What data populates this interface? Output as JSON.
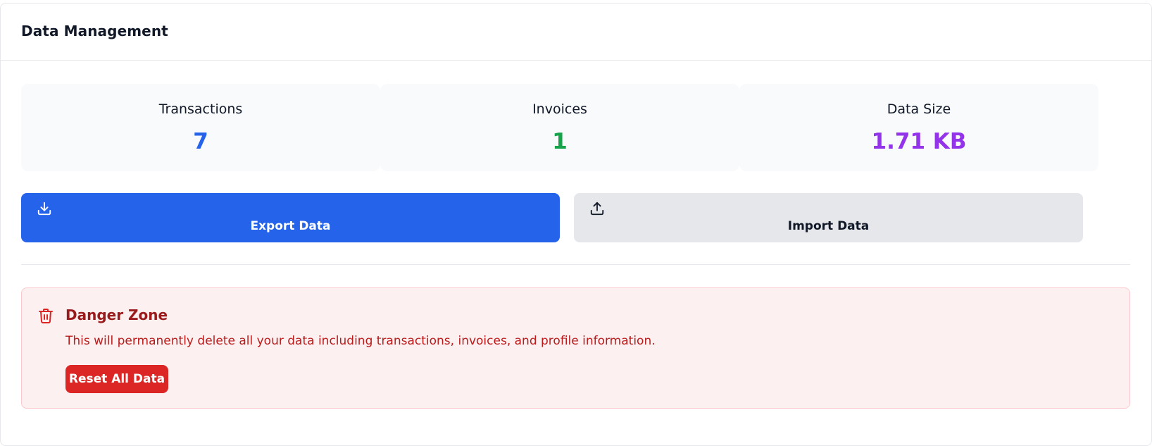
{
  "header": {
    "title": "Data Management"
  },
  "stats": [
    {
      "label": "Transactions",
      "value": "7",
      "color": "#2563eb"
    },
    {
      "label": "Invoices",
      "value": "1",
      "color": "#16a34a"
    },
    {
      "label": "Data Size",
      "value": "1.71 KB",
      "color": "#9333ea"
    }
  ],
  "actions": {
    "export": {
      "label": "Export Data",
      "icon": "download-icon",
      "bg": "#2563eb",
      "fg": "#ffffff"
    },
    "import": {
      "label": "Import Data",
      "icon": "upload-icon",
      "bg": "#e5e7eb",
      "fg": "#111827"
    }
  },
  "danger_zone": {
    "icon": "trash-icon",
    "title": "Danger Zone",
    "description": "This will permanently delete all your data including transactions, invoices, and profile information.",
    "reset_label": "Reset All Data",
    "reset_color": "#dc2626"
  }
}
